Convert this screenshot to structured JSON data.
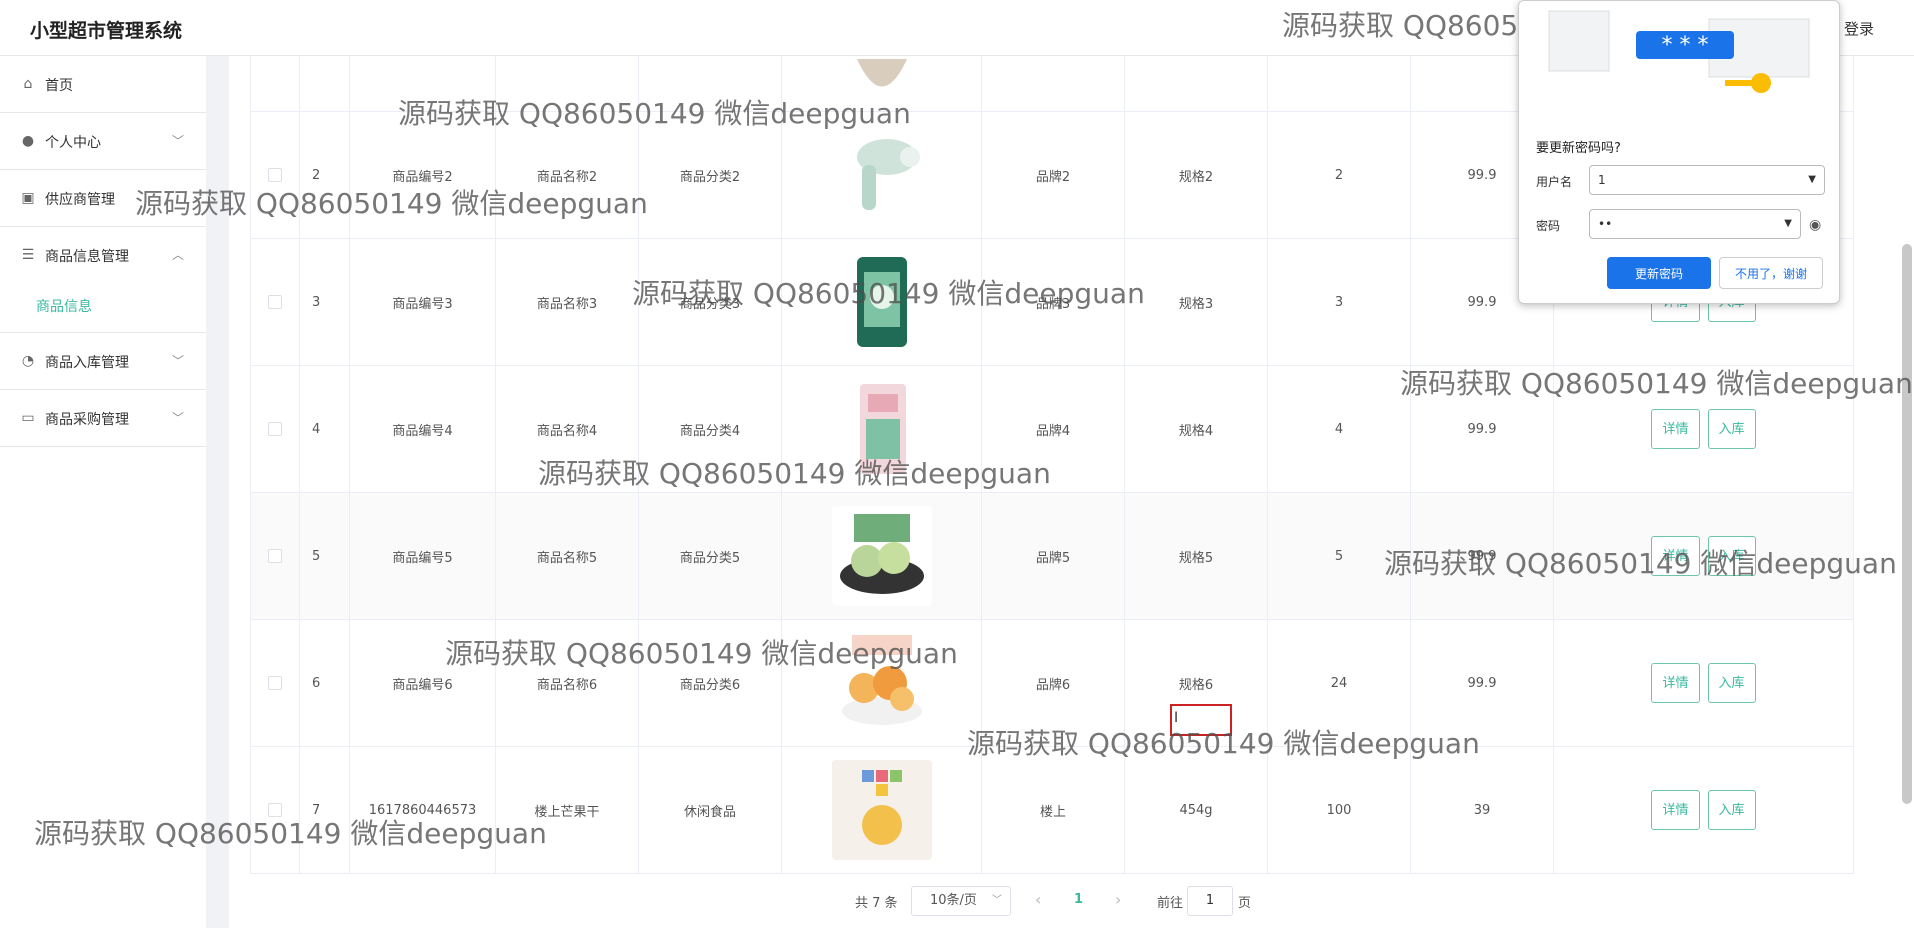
{
  "app": {
    "title": "小型超市管理系统",
    "logout": "登录"
  },
  "sidebar": {
    "items": [
      {
        "label": "首页",
        "icon": "home-icon"
      },
      {
        "label": "个人中心",
        "icon": "user-icon"
      },
      {
        "label": "供应商管理",
        "icon": "clipboard-icon"
      },
      {
        "label": "商品信息管理",
        "icon": "sliders-icon"
      },
      {
        "label": "商品入库管理",
        "icon": "compass-icon"
      },
      {
        "label": "商品采购管理",
        "icon": "chat-icon"
      }
    ],
    "submenu": {
      "label": "商品信息"
    }
  },
  "table": {
    "rows": [
      {
        "no": "2",
        "code": "商品编号2",
        "name": "商品名称2",
        "category": "商品分类2",
        "brand": "品牌2",
        "spec": "规格2",
        "qty": "2",
        "price": "99.9",
        "image": "hair-dryer"
      },
      {
        "no": "3",
        "code": "商品编号3",
        "name": "商品名称3",
        "category": "商品分类3",
        "brand": "品牌3",
        "spec": "规格3",
        "qty": "3",
        "price": "99.9",
        "image": "rice-bag"
      },
      {
        "no": "4",
        "code": "商品编号4",
        "name": "商品名称4",
        "category": "商品分类4",
        "brand": "品牌4",
        "spec": "规格4",
        "qty": "4",
        "price": "99.9",
        "image": "snack-bag"
      },
      {
        "no": "5",
        "code": "商品编号5",
        "name": "商品名称5",
        "category": "商品分类5",
        "brand": "品牌5",
        "spec": "规格5",
        "qty": "5",
        "price": "99.9",
        "image": "green-cakes"
      },
      {
        "no": "6",
        "code": "商品编号6",
        "name": "商品名称6",
        "category": "商品分类6",
        "brand": "品牌6",
        "spec": "规格6",
        "qty": "24",
        "price": "99.9",
        "image": "puffs"
      },
      {
        "no": "7",
        "code": "1617860446573",
        "name": "楼上芒果干",
        "category": "休闲食品",
        "brand": "楼上",
        "spec": "454g",
        "qty": "100",
        "price": "39",
        "image": "mango-pack"
      }
    ],
    "detail_label": "详情",
    "stock_label": "入库"
  },
  "pager": {
    "total": "共 7 条",
    "page_size": "10条/页",
    "current": "1",
    "goto": "前往",
    "goto_value": "1",
    "page_word": "页"
  },
  "password_prompt": {
    "question": "要更新密码吗?",
    "username_label": "用户名",
    "username_value": "1",
    "password_label": "密码",
    "password_value": "••",
    "update_label": "更新密码",
    "dismiss_label": "不用了，谢谢",
    "stars": "* * *"
  },
  "watermark": "源码获取 QQ86050149 微信deepguan",
  "colors": {
    "accent": "#3bb9a0",
    "primary_blue": "#1a73e8"
  }
}
